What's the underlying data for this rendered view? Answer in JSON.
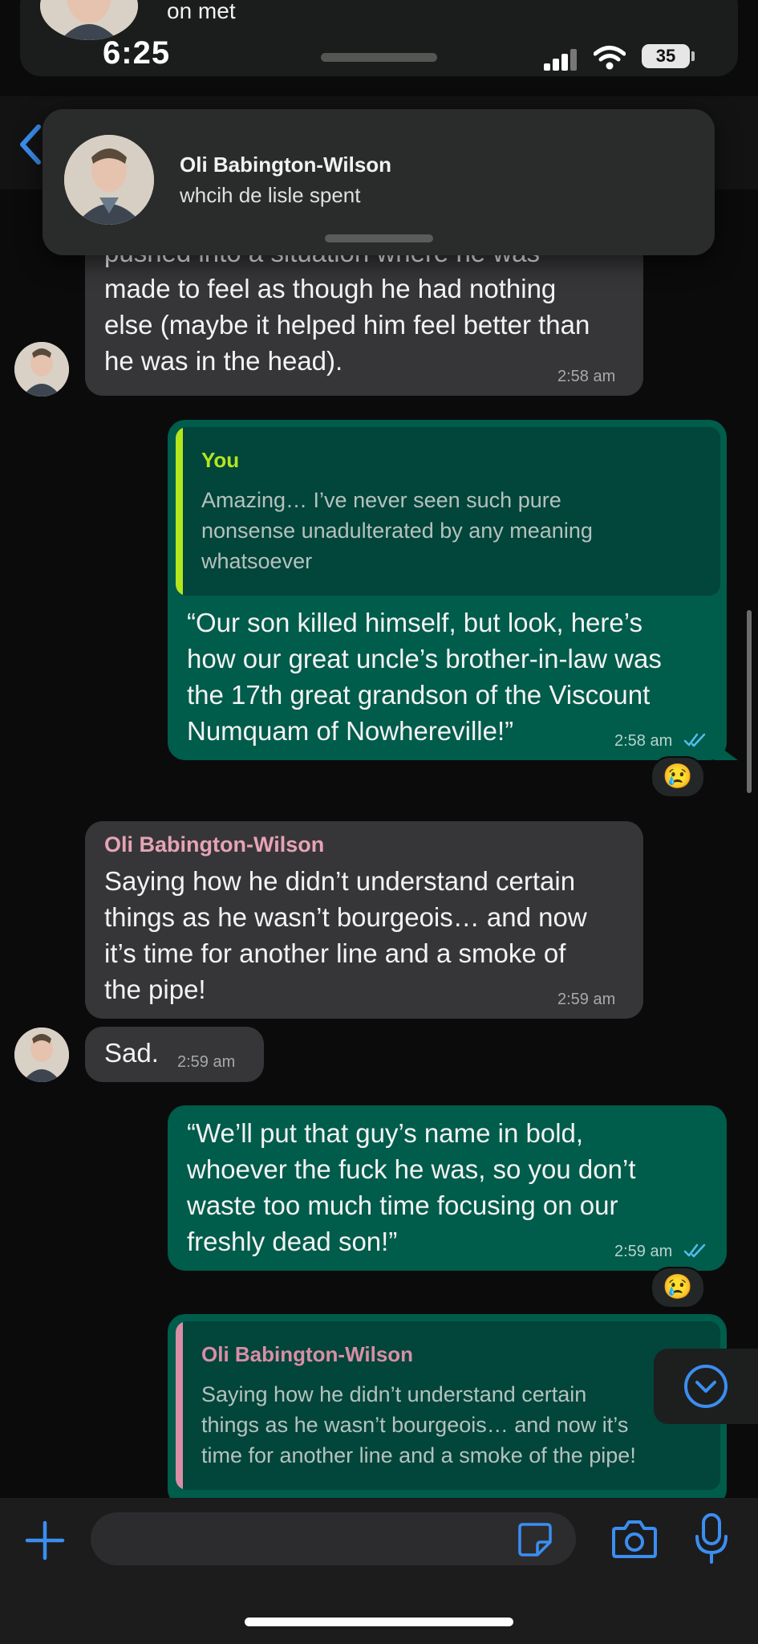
{
  "status_bar": {
    "sender_preview": "on met",
    "time": "6:25",
    "battery": "35"
  },
  "notification": {
    "name": "Oli Babington-Wilson",
    "message": "whcih de lisle spent"
  },
  "messages": {
    "m1": {
      "lines": [
        "pushed into a situation where he was",
        "made to feel as though he had nothing",
        "else (maybe it helped him feel better than",
        "he was in the head)."
      ],
      "time": "2:58 am"
    },
    "m2": {
      "quote_author": "You",
      "quote_lines": [
        "Amazing… I’ve never seen such pure",
        "nonsense unadulterated by any meaning",
        "whatsoever"
      ],
      "lines": [
        "“Our son killed himself, but look, here’s",
        "how our great uncle’s brother-in-law was",
        "the 17th great grandson of the Viscount",
        "Numquam of Nowhereville!”"
      ],
      "time": "2:58 am",
      "reaction": "😢"
    },
    "m3": {
      "sender": "Oli Babington-Wilson",
      "lines": [
        "Saying how he didn’t understand certain",
        "things as he wasn’t bourgeois… and now",
        "it’s time for another line and a smoke of",
        "the pipe!"
      ],
      "time": "2:59 am"
    },
    "m4": {
      "text": "Sad.",
      "time": "2:59 am"
    },
    "m5": {
      "lines": [
        "“We’ll put that guy’s name in bold,",
        "whoever the fuck he was, so you don’t",
        "waste too much time focusing on our",
        "freshly dead son!”"
      ],
      "time": "2:59 am",
      "reaction": "😢"
    },
    "m6": {
      "quote_author": "Oli Babington-Wilson",
      "quote_lines": [
        "Saying how he didn’t understand certain",
        "things as he wasn’t bourgeois… and now it’s",
        "time for another line and a smoke of the pipe!"
      ]
    }
  },
  "composer": {
    "value": ""
  },
  "colors": {
    "accent": "#3b8ef0",
    "outgoing_bubble": "#005c4b",
    "incoming_bubble": "#363638",
    "quote_you_bar": "#b4e61e",
    "quote_other_bar": "#d98ea6",
    "read_ticks": "#53bdeb"
  },
  "icons": {
    "back": "chevron-left-icon",
    "add": "plus-icon",
    "sticker": "sticker-icon",
    "camera": "camera-icon",
    "mic": "microphone-icon",
    "scroll_down": "chevron-down-circle-icon"
  }
}
